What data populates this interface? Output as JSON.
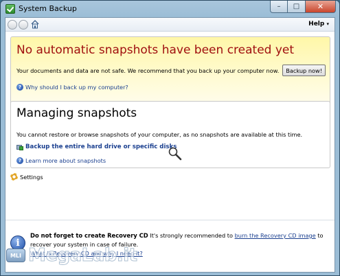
{
  "window": {
    "title": "System Backup",
    "minimize_glyph": "–",
    "maximize_glyph": "□",
    "close_glyph": "✕"
  },
  "navbar": {
    "help_label": "Help",
    "help_caret": "▾"
  },
  "alert": {
    "title": "No automatic snapshots have been created yet",
    "text": "Your documents and data are not safe. We recommend that you back up your computer now.",
    "button_label": "Backup now!",
    "help_link": "Why should I back up my computer?"
  },
  "snapshots": {
    "title": "Managing snapshots",
    "text": "You cannot restore or browse snapshots of your computer, as no snapshots are available at this time.",
    "backup_link": "Backup the entire hard drive or specific disks",
    "learn_link": "Learn more about snapshots"
  },
  "settings": {
    "label": "Settings"
  },
  "bottom": {
    "bold": "Do not forget to create Recovery CD",
    "text_before": " It's strongly recommended to ",
    "link1": "burn the Recovery CD image",
    "text_after": " to recover your system in case of failure.",
    "link2": "What is Recovery CD and why I need it?"
  },
  "icons": {
    "question": "?",
    "info": "i"
  },
  "watermark": {
    "badge": "MLI",
    "text": "MegaLab.it"
  },
  "colors": {
    "alert_title": "#a01010",
    "link": "#1a3f8f",
    "alert_bg": "#fff7a8"
  }
}
